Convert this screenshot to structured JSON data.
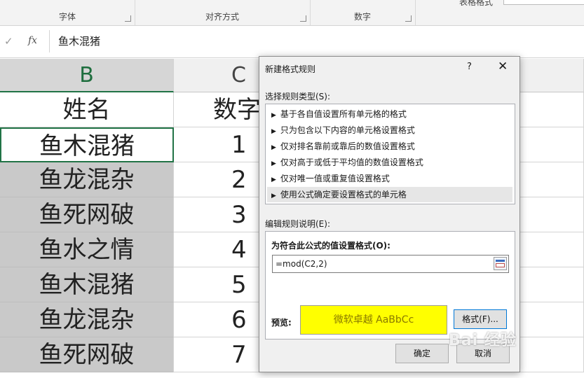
{
  "ribbon": {
    "groups": [
      "字体",
      "对齐方式",
      "数字"
    ],
    "table_style": "表格格式"
  },
  "formula_bar": {
    "check_glyph": "✓",
    "fx_label": "fx",
    "value": "鱼木混猪"
  },
  "grid": {
    "columns": [
      "B",
      "C"
    ],
    "rows": [
      {
        "b": "姓名",
        "c": "数字"
      },
      {
        "b": "鱼木混猪",
        "c": "1"
      },
      {
        "b": "鱼龙混杂",
        "c": "2"
      },
      {
        "b": "鱼死网破",
        "c": "3"
      },
      {
        "b": "鱼水之情",
        "c": "4"
      },
      {
        "b": "鱼木混猪",
        "c": "5"
      },
      {
        "b": "鱼龙混杂",
        "c": "6"
      },
      {
        "b": "鱼死网破",
        "c": "7"
      }
    ]
  },
  "dialog": {
    "title": "新建格式规则",
    "help": "?",
    "close": "✕",
    "select_type_label": "选择规则类型(S):",
    "rule_types": [
      "基于各自值设置所有单元格的格式",
      "只为包含以下内容的单元格设置格式",
      "仅对排名靠前或靠后的数值设置格式",
      "仅对高于或低于平均值的数值设置格式",
      "仅对唯一值或重复值设置格式",
      "使用公式确定要设置格式的单元格"
    ],
    "selected_rule_index": 5,
    "edit_label": "编辑规则说明(E):",
    "formula_label": "为符合此公式的值设置格式(O):",
    "formula_value": "=mod(C2,2)",
    "preview_label": "预览:",
    "preview_text": "微软卓越 AaBbCc",
    "preview_color": "#ffff00",
    "format_button": "格式(F)...",
    "ok_button": "确定",
    "cancel_button": "取消"
  },
  "watermark": "Bai 经验",
  "colors": {
    "excel_green": "#217346",
    "selected_cell_fill": "#c9c9c9"
  }
}
